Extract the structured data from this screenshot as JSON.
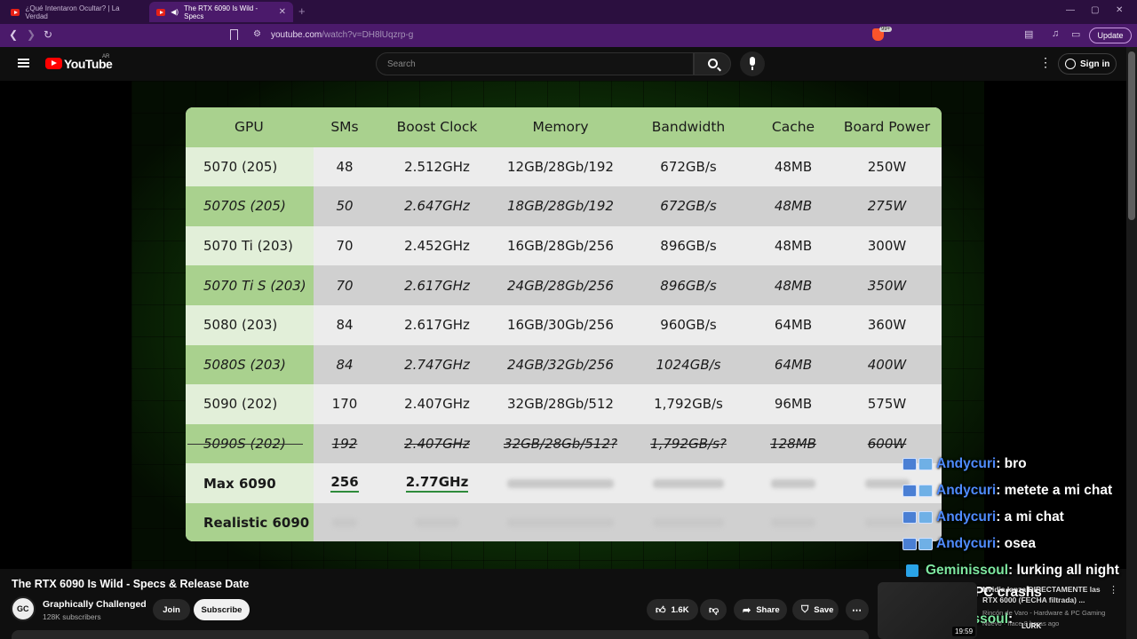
{
  "browser": {
    "tabs": [
      {
        "title": "¿Qué Intentaron Ocultar? | La Verdad"
      },
      {
        "title": "The RTX 6090 Is Wild - Specs"
      }
    ],
    "new_tab": "+",
    "url_domain": "youtube.com",
    "url_path": "/watch?v=DH8lUqzrp-g",
    "update_label": "Update",
    "brave_badge": "99+"
  },
  "youtube": {
    "logo_text": "YouTube",
    "country": "AR",
    "search_placeholder": "Search",
    "signin_label": "Sign in"
  },
  "spec_table": {
    "headers": [
      "GPU",
      "SMs",
      "Boost Clock",
      "Memory",
      "Bandwidth",
      "Cache",
      "Board Power"
    ],
    "rows": [
      [
        "5070 (205)",
        "48",
        "2.512GHz",
        "12GB/28Gb/192",
        "672GB/s",
        "48MB",
        "250W"
      ],
      [
        "5070S (205)",
        "50",
        "2.647GHz",
        "18GB/28Gb/192",
        "672GB/s",
        "48MB",
        "275W"
      ],
      [
        "5070 Ti (203)",
        "70",
        "2.452GHz",
        "16GB/28Gb/256",
        "896GB/s",
        "48MB",
        "300W"
      ],
      [
        "5070 Ti S (203)",
        "70",
        "2.617GHz",
        "24GB/28Gb/256",
        "896GB/s",
        "48MB",
        "350W"
      ],
      [
        "5080 (203)",
        "84",
        "2.617GHz",
        "16GB/30Gb/256",
        "960GB/s",
        "64MB",
        "360W"
      ],
      [
        "5080S (203)",
        "84",
        "2.747GHz",
        "24GB/32Gb/256",
        "1024GB/s",
        "64MB",
        "400W"
      ],
      [
        "5090 (202)",
        "170",
        "2.407GHz",
        "32GB/28Gb/512",
        "1,792GB/s",
        "96MB",
        "575W"
      ],
      [
        "5090S (202)",
        "192",
        "2.407GHz",
        "32GB/28Gb/512?",
        "1,792GB/s?",
        "128MB",
        "600W"
      ],
      [
        "Max 6090",
        "256",
        "2.77GHz",
        "",
        "",
        "",
        ""
      ],
      [
        "Realistic 6090",
        "",
        "",
        "",
        "",
        "",
        ""
      ]
    ]
  },
  "chat": [
    {
      "user": "Andycuri",
      "msg": ": bro"
    },
    {
      "user": "Andycuri",
      "msg": ": metete a mi chat"
    },
    {
      "user": "Andycuri",
      "msg": ": a mi chat"
    },
    {
      "user": "Andycuri",
      "msg": ": osea"
    },
    {
      "user": "Geminissoul",
      "msg": ": lurking all night"
    },
    {
      "user": "",
      "msg": "unless the PC crashs"
    },
    {
      "user": "Geminissoul",
      "msg": ":"
    }
  ],
  "video": {
    "title": "The RTX 6090 Is Wild - Specs & Release Date",
    "channel": "Graphically Challenged",
    "subscribers": "128K subscribers",
    "join_label": "Join",
    "subscribe_label": "Subscribe",
    "likes": "1.6K",
    "share_label": "Share",
    "save_label": "Save"
  },
  "recommendation": {
    "title": "Nvidia lanza DIRECTAMENTE las RTX 6000 (FECHA filtrada) ...",
    "channel": "Rincón de Varo - Hardware & PC Gaming",
    "meta": "Nuevo · hace 8 horas ago",
    "duration": "19:59",
    "overlay_label": "LURK"
  },
  "colors": {
    "header_green": "#a9d18e",
    "light_green": "#e2efd9",
    "chat_user_blue": "#4f8cff",
    "chat_user_green": "#7ee8a0",
    "browser_purple": "#4b1a6b"
  }
}
